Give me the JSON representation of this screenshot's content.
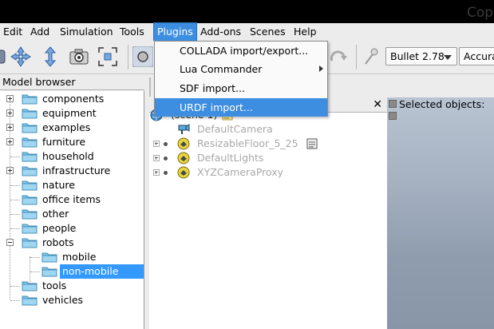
{
  "window": {
    "title": "Cop"
  },
  "menubar": {
    "items": [
      {
        "label": "Edit"
      },
      {
        "label": "Add"
      },
      {
        "label": "Simulation"
      },
      {
        "label": "Tools"
      },
      {
        "label": "Plugins",
        "active": true
      },
      {
        "label": "Add-ons"
      },
      {
        "label": "Scenes"
      },
      {
        "label": "Help"
      }
    ]
  },
  "plugins_menu": {
    "items": [
      {
        "label": "COLLADA import/export..."
      },
      {
        "label": "Lua Commander",
        "submenu": true
      },
      {
        "label": "SDF import..."
      },
      {
        "label": "URDF import...",
        "highlighted": true
      }
    ]
  },
  "toolbar": {
    "engine": "Bullet 2.78",
    "accuracy": "Accura",
    "icons": [
      "move-icon",
      "rotate-icon",
      "camera-icon",
      "fit-view-icon",
      "select-icon",
      "redo-icon",
      "pin-icon"
    ]
  },
  "model_browser": {
    "title": "Model browser",
    "items": [
      {
        "label": "components",
        "expand": "plus",
        "depth": 0
      },
      {
        "label": "equipment",
        "expand": "plus",
        "depth": 0
      },
      {
        "label": "examples",
        "expand": "plus",
        "depth": 0
      },
      {
        "label": "furniture",
        "expand": "plus",
        "depth": 0
      },
      {
        "label": "household",
        "expand": "none",
        "depth": 0
      },
      {
        "label": "infrastructure",
        "expand": "plus",
        "depth": 0
      },
      {
        "label": "nature",
        "expand": "none",
        "depth": 0
      },
      {
        "label": "office items",
        "expand": "none",
        "depth": 0
      },
      {
        "label": "other",
        "expand": "none",
        "depth": 0
      },
      {
        "label": "people",
        "expand": "none",
        "depth": 0
      },
      {
        "label": "robots",
        "expand": "minus",
        "depth": 0
      },
      {
        "label": "mobile",
        "expand": "none",
        "depth": 1
      },
      {
        "label": "non-mobile",
        "expand": "none",
        "depth": 1,
        "selected": true
      },
      {
        "label": "tools",
        "expand": "none",
        "depth": 0
      },
      {
        "label": "vehicles",
        "expand": "none",
        "depth": 0
      }
    ]
  },
  "scene_hierarchy": {
    "close_label": "✕",
    "root": "(scene 1)",
    "items": [
      {
        "label": "DefaultCamera",
        "icon": "camera-object-icon"
      },
      {
        "label": "ResizableFloor_5_25",
        "icon": "shape-object-icon",
        "script": true
      },
      {
        "label": "DefaultLights",
        "icon": "shape-object-icon"
      },
      {
        "label": "XYZCameraProxy",
        "icon": "shape-object-icon"
      }
    ]
  },
  "selection": {
    "label": "Selected objects:"
  },
  "colors": {
    "accent": "#3d8ee0",
    "selection": "#3399ff",
    "folder": "#7fc4e8"
  }
}
